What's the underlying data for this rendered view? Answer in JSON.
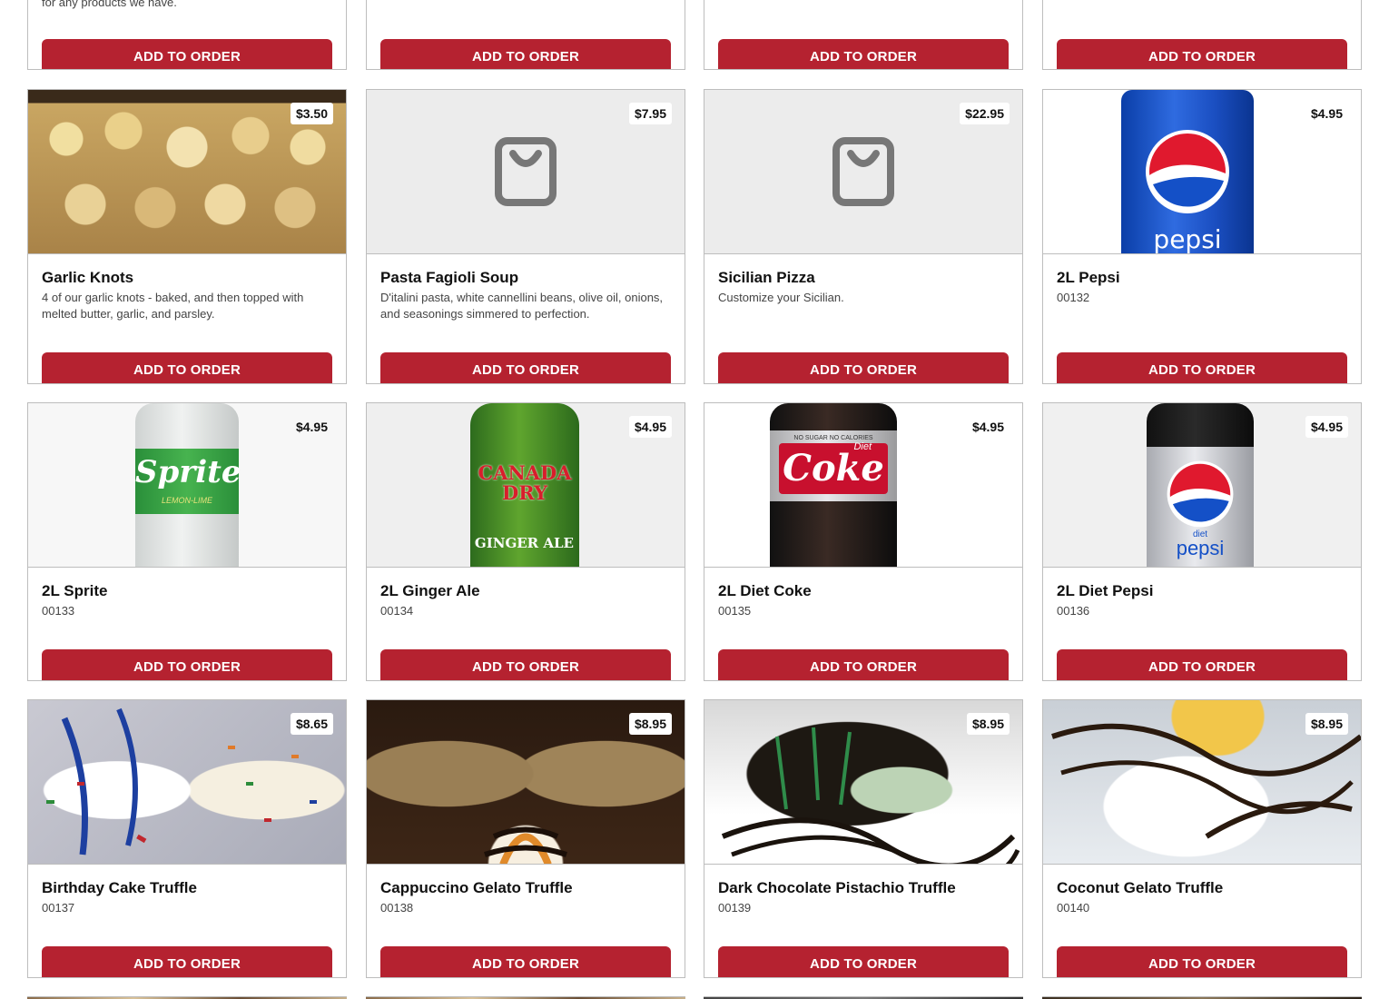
{
  "top_row": {
    "first_desc": "for any products we have.",
    "button_label": "ADD TO ORDER"
  },
  "row1": [
    {
      "name": "Garlic Knots",
      "price": "$3.50",
      "desc": "4 of our garlic knots - baked, and then topped with melted butter, garlic, and parsley.",
      "button": "ADD TO ORDER",
      "image": "garlic-knots-photo"
    },
    {
      "name": "Pasta Fagioli Soup",
      "price": "$7.95",
      "desc": "D'italini pasta, white cannellini beans, olive oil, onions, and seasonings simmered to perfection.",
      "button": "ADD TO ORDER",
      "image": "shopping-bag-icon"
    },
    {
      "name": "Sicilian Pizza",
      "price": "$22.95",
      "desc": "Customize your Sicilian.",
      "button": "ADD TO ORDER",
      "image": "shopping-bag-icon"
    },
    {
      "name": "2L Pepsi",
      "price": "$4.95",
      "desc": "00132",
      "button": "ADD TO ORDER",
      "image": "pepsi-bottle-photo",
      "logo_text": "pepsi"
    }
  ],
  "row2": [
    {
      "name": "2L Sprite",
      "price": "$4.95",
      "desc": "00133",
      "button": "ADD TO ORDER",
      "image": "sprite-bottle-photo",
      "logo_text": "Sprite",
      "logo_sub": "LEMON-LIME"
    },
    {
      "name": "2L Ginger Ale",
      "price": "$4.95",
      "desc": "00134",
      "button": "ADD TO ORDER",
      "image": "canada-dry-bottle-photo",
      "logo_text": "CANADA DRY",
      "logo_sub": "GINGER ALE"
    },
    {
      "name": "2L Diet Coke",
      "price": "$4.95",
      "desc": "00135",
      "button": "ADD TO ORDER",
      "image": "diet-coke-bottle-photo",
      "logo_text": "Coke",
      "logo_top": "NO SUGAR NO CALORIES",
      "logo_small": "Diet"
    },
    {
      "name": "2L Diet Pepsi",
      "price": "$4.95",
      "desc": "00136",
      "button": "ADD TO ORDER",
      "image": "diet-pepsi-bottle-photo",
      "logo_text": "pepsi",
      "logo_small": "diet"
    }
  ],
  "row3": [
    {
      "name": "Birthday Cake Truffle",
      "price": "$8.65",
      "desc": "00137",
      "button": "ADD TO ORDER",
      "image": "birthday-cake-truffle-photo"
    },
    {
      "name": "Cappuccino Gelato Truffle",
      "price": "$8.95",
      "desc": "00138",
      "button": "ADD TO ORDER",
      "image": "cappuccino-truffle-photo"
    },
    {
      "name": "Dark Chocolate Pistachio Truffle",
      "price": "$8.95",
      "desc": "00139",
      "button": "ADD TO ORDER",
      "image": "pistachio-truffle-photo"
    },
    {
      "name": "Coconut Gelato Truffle",
      "price": "$8.95",
      "desc": "00140",
      "button": "ADD TO ORDER",
      "image": "coconut-truffle-photo"
    }
  ],
  "colors": {
    "button": "#b52230",
    "border": "#bdbdbd",
    "placeholder_bg": "#ececec"
  }
}
